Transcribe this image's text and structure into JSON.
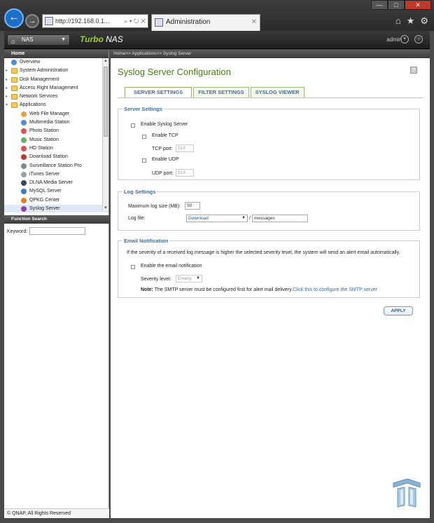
{
  "browser": {
    "address": "http://192.168.0.1...",
    "address_controls": "⌕ ▾ ↻ ✕",
    "tab_title": "Administration",
    "tab_close": "✕",
    "win_min": "—",
    "win_max": "□",
    "win_close": "✕",
    "icons": [
      "home-icon",
      "star-icon",
      "gear-icon"
    ]
  },
  "header": {
    "nas_button": "NAS",
    "brand_main": "Turbo",
    "brand_sub": "NAS",
    "user": "admin"
  },
  "left": {
    "home_label": "Home",
    "tree": [
      {
        "label": "Overview",
        "level": 0,
        "icon": "overview-icon",
        "expand": ""
      },
      {
        "label": "System Administration",
        "level": 0,
        "icon": "folder-icon",
        "expand": "▸"
      },
      {
        "label": "Disk Management",
        "level": 0,
        "icon": "folder-icon",
        "expand": "▸"
      },
      {
        "label": "Access Right Management",
        "level": 0,
        "icon": "folder-icon",
        "expand": "▸"
      },
      {
        "label": "Network Services",
        "level": 0,
        "icon": "folder-icon",
        "expand": "▸"
      },
      {
        "label": "Applications",
        "level": 0,
        "icon": "folder-icon",
        "expand": "▾"
      },
      {
        "label": "Web File Manager",
        "level": 1,
        "icon": "web-file-manager-icon",
        "expand": ""
      },
      {
        "label": "Multimedia Station",
        "level": 1,
        "icon": "multimedia-station-icon",
        "expand": ""
      },
      {
        "label": "Photo Station",
        "level": 1,
        "icon": "photo-station-icon",
        "expand": ""
      },
      {
        "label": "Music Station",
        "level": 1,
        "icon": "music-station-icon",
        "expand": ""
      },
      {
        "label": "HD Station",
        "level": 1,
        "icon": "hd-station-icon",
        "expand": ""
      },
      {
        "label": "Download Station",
        "level": 1,
        "icon": "download-station-icon",
        "expand": ""
      },
      {
        "label": "Surveillance Station Pro",
        "level": 1,
        "icon": "surveillance-station-icon",
        "expand": ""
      },
      {
        "label": "iTunes Server",
        "level": 1,
        "icon": "itunes-server-icon",
        "expand": ""
      },
      {
        "label": "DLNA Media Server",
        "level": 1,
        "icon": "dlna-media-server-icon",
        "expand": ""
      },
      {
        "label": "MySQL Server",
        "level": 1,
        "icon": "mysql-server-icon",
        "expand": ""
      },
      {
        "label": "QPKG Center",
        "level": 1,
        "icon": "qpkg-center-icon",
        "expand": ""
      },
      {
        "label": "Syslog Server",
        "level": 1,
        "icon": "syslog-server-icon",
        "expand": ""
      }
    ],
    "function_search": "Function Search",
    "keyword_label": "Keyword:",
    "footer": "© QNAP, All Rights Reserved"
  },
  "breadcrumb": "Home>> Applications>> Syslog Server",
  "page_title": "Syslog Server Configuration",
  "help_label": "?",
  "tabs": [
    "SERVER SETTINGS",
    "FILTER SETTINGS",
    "SYSLOG VIEWER"
  ],
  "server_settings": {
    "legend": "Server Settings",
    "enable_syslog": "Enable Syslog Server",
    "enable_tcp": "Enable TCP",
    "tcp_port_label": "TCP port:",
    "tcp_port": "514",
    "enable_udp": "Enable UDP",
    "udp_port_label": "UDP port:",
    "udp_port": "514"
  },
  "log_settings": {
    "legend": "Log Settings",
    "max_size_label": "Maximum log size (MB):",
    "max_size": "50",
    "log_file_label": "Log file:",
    "log_folder": "Download",
    "separator": "/",
    "log_name": "messages"
  },
  "email": {
    "legend": "Email Notification",
    "description": "If the severity of a received log message is higher the selected severity level, the system will send an alert email automatically.",
    "enable_label": "Enable the email notification",
    "severity_label": "Severity level:",
    "severity_value": "Emerg",
    "note_bold": "Note:",
    "note_text": "The SMTP server must be configured first for alert mail delivery.",
    "note_link": "Click this to configure the SMTP server"
  },
  "apply_label": "APPLY",
  "colors": {
    "title_green": "#4a7a1a",
    "link_blue": "#2a6fbf",
    "tab_blue": "#3d6fa0"
  }
}
